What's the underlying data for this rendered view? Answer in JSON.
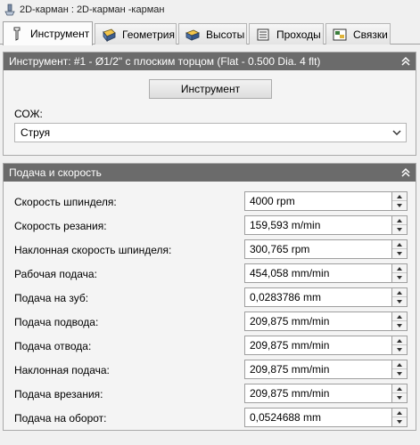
{
  "window": {
    "title": "2D-карман : 2D-карман -карман"
  },
  "tabs": [
    {
      "label": "Инструмент",
      "icon": "tool-icon",
      "active": true
    },
    {
      "label": "Геометрия",
      "icon": "geometry-icon",
      "active": false
    },
    {
      "label": "Высоты",
      "icon": "heights-icon",
      "active": false
    },
    {
      "label": "Проходы",
      "icon": "passes-icon",
      "active": false
    },
    {
      "label": "Связки",
      "icon": "linking-icon",
      "active": false
    }
  ],
  "tool_panel": {
    "header": "Инструмент: #1 - Ø1/2\" с плоским торцом (Flat - 0.500 Dia. 4 flt)",
    "button_label": "Инструмент",
    "coolant_label": "СОЖ:",
    "coolant_value": "Струя"
  },
  "feed_panel": {
    "header": "Подача и скорость",
    "fields": [
      {
        "label": "Скорость шпинделя:",
        "value": "4000 rpm"
      },
      {
        "label": "Скорость резания:",
        "value": "159,593 m/min"
      },
      {
        "label": "Наклонная скорость шпинделя:",
        "value": "300,765 rpm"
      },
      {
        "label": "Рабочая подача:",
        "value": "454,058 mm/min"
      },
      {
        "label": "Подача на зуб:",
        "value": "0,0283786 mm"
      },
      {
        "label": "Подача подвода:",
        "value": "209,875 mm/min"
      },
      {
        "label": "Подача отвода:",
        "value": "209,875 mm/min"
      },
      {
        "label": "Наклонная подача:",
        "value": "209,875 mm/min"
      },
      {
        "label": "Подача врезания:",
        "value": "209,875 mm/min"
      },
      {
        "label": "Подача на оборот:",
        "value": "0,0524688 mm"
      }
    ]
  },
  "colors": {
    "panel_header": "#6b6b6b",
    "background": "#f0f0f0"
  }
}
